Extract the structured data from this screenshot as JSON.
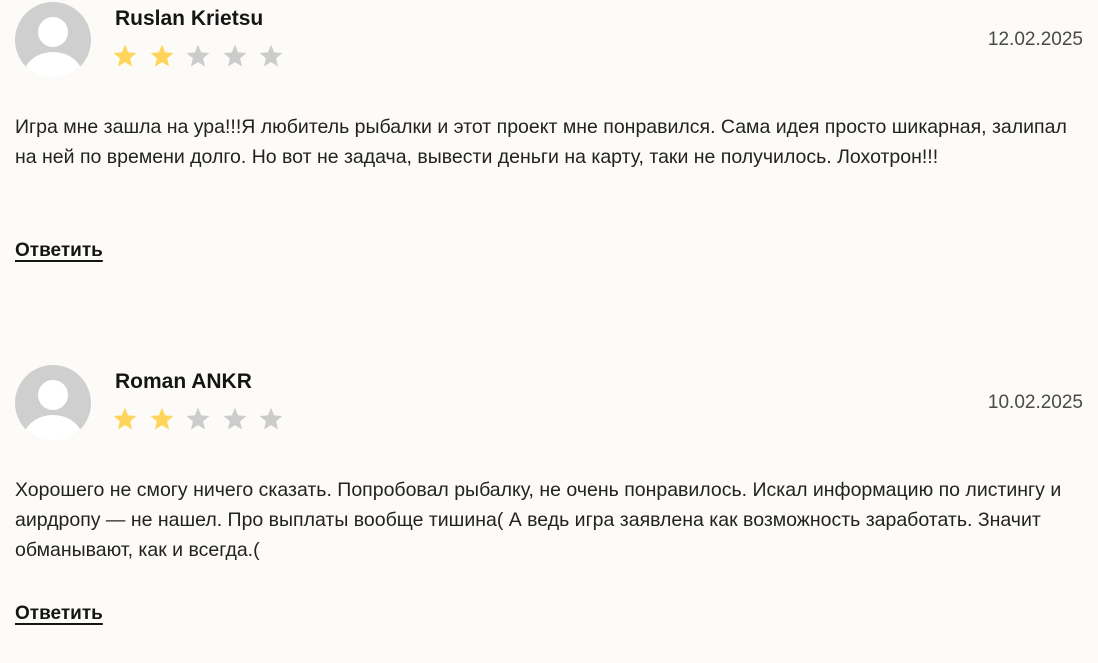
{
  "reviews": [
    {
      "author": "Ruslan Krietsu",
      "date": "12.02.2025",
      "rating": 2,
      "max_rating": 5,
      "text": "Игра мне зашла на ура!!!Я любитель рыбалки и этот проект мне понравился. Сама идея просто шикарная, залипал на ней по времени долго. Но вот не задача, вывести деньги на карту, таки не получилось. Лохотрон!!!",
      "reply_label": "Ответить"
    },
    {
      "author": "Roman ANKR",
      "date": "10.02.2025",
      "rating": 2,
      "max_rating": 5,
      "text": "Хорошего не смогу ничего сказать. Попробовал рыбалку, не очень понравилось. Искал информацию по листингу и аирдропу — не нашел. Про выплаты вообще тишина( А ведь игра заявлена как возможность заработать. Значит обманывают, как и всегда.(",
      "reply_label": "Ответить"
    }
  ],
  "colors": {
    "star_filled": "#ffd45a",
    "star_empty": "#cccccc",
    "avatar_bg": "#cfcfcf",
    "page_bg": "#fdfbf8"
  },
  "icons": {
    "avatar": "user-silhouette-icon",
    "star": "star-icon"
  }
}
